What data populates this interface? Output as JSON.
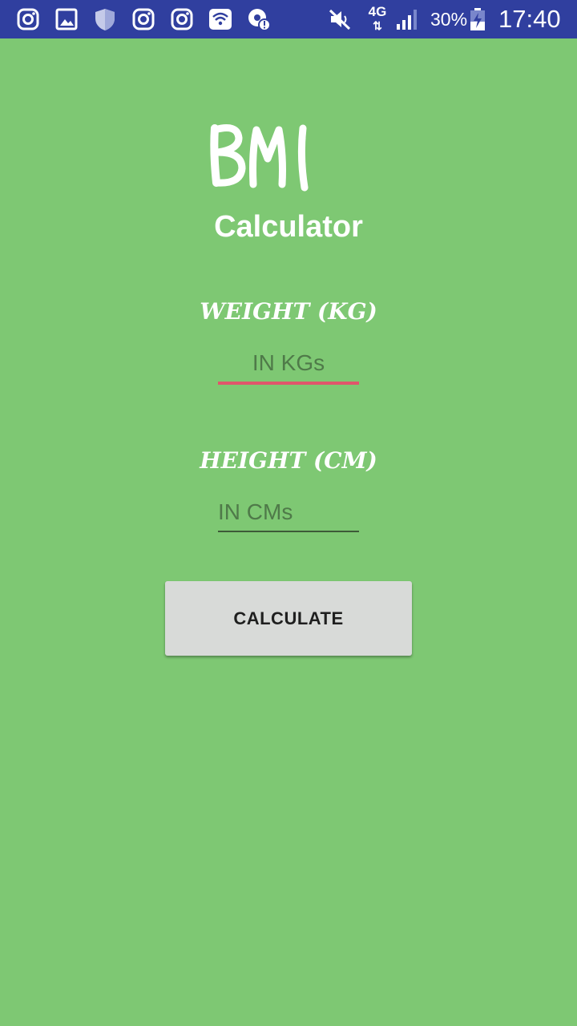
{
  "status_bar": {
    "background": "#303f9f",
    "notification_icons": [
      "instagram-icon",
      "gallery-icon",
      "shield-icon",
      "instagram-icon",
      "instagram-icon",
      "wifi-icon",
      "location-alert-icon"
    ],
    "mute_icon": "vibrate-mute-icon",
    "network_type": "4G",
    "signal_icon": "cell-signal-icon",
    "battery_percent": "30%",
    "battery_icon": "battery-charging-icon",
    "time": "17:40"
  },
  "app": {
    "background": "#7ec873",
    "logo_text": "BMI",
    "subtitle": "Calculator",
    "weight": {
      "label": "WEIGHT (KG)",
      "placeholder": "IN KGs",
      "value": "",
      "underline_color": "#e0566b"
    },
    "height": {
      "label": "HEIGHT (CM)",
      "placeholder": "IN CMs",
      "value": ""
    },
    "calculate_label": "CALCULATE"
  }
}
